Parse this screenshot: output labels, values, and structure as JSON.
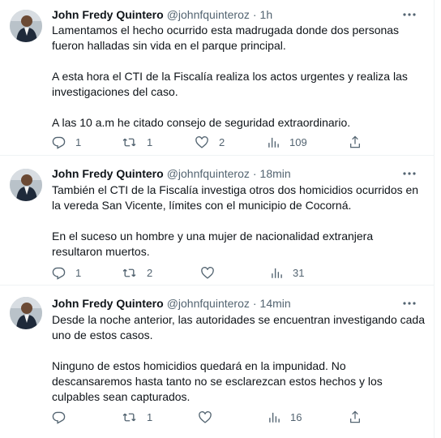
{
  "tweets": [
    {
      "author_name": "John Fredy Quintero",
      "handle": "@johnfquinteroz",
      "separator": "·",
      "time": "1h",
      "paragraphs": [
        "Lamentamos el hecho ocurrido esta madrugada donde dos personas fueron halladas sin vida en el parque principal.",
        "A esta hora el CTI de la Fiscalía realiza los actos urgentes y realiza las investigaciones del caso.",
        "A las 10 a.m he citado consejo de seguridad extraordinario."
      ],
      "replies": "1",
      "retweets": "1",
      "likes": "2",
      "views": "109"
    },
    {
      "author_name": "John Fredy Quintero",
      "handle": "@johnfquinteroz",
      "separator": "·",
      "time": "18min",
      "paragraphs": [
        "También el CTI de la Fiscalía investiga otros dos homicidios ocurridos en la vereda San Vicente, límites con el municipio de Cocorná.",
        "En el suceso un hombre y una mujer de nacionalidad extranjera resultaron muertos."
      ],
      "replies": "1",
      "retweets": "2",
      "likes": "",
      "views": "31"
    },
    {
      "author_name": "John Fredy Quintero",
      "handle": "@johnfquinteroz",
      "separator": "·",
      "time": "14min",
      "paragraphs": [
        "Desde la noche anterior, las autoridades se encuentran investigando cada uno de estos casos.",
        "Ninguno de estos homicidios quedará en la impunidad. No descansaremos hasta tanto no se esclarezcan estos hechos y los culpables sean capturados."
      ],
      "replies": "",
      "retweets": "1",
      "likes": "",
      "views": "16"
    }
  ],
  "colors": {
    "text": "#0f1419",
    "secondary": "#536471",
    "border": "#eff3f4"
  },
  "icons": [
    "more-icon",
    "reply-icon",
    "retweet-icon",
    "like-icon",
    "views-icon",
    "share-icon"
  ]
}
